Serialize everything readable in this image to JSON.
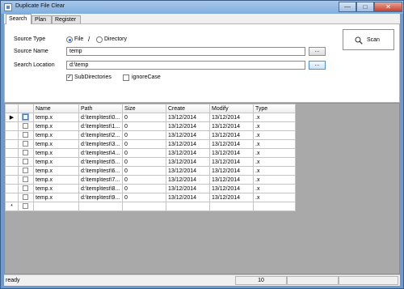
{
  "window": {
    "title": "Duplicate File Clear",
    "minimize_glyph": "—",
    "maximize_glyph": "□",
    "close_glyph": "✕"
  },
  "tabs": [
    {
      "label": "Search"
    },
    {
      "label": "Plan"
    },
    {
      "label": "Register"
    }
  ],
  "search": {
    "source_type_label": "Source Type",
    "source_name_label": "Source Name",
    "search_location_label": "Search Location",
    "file_option_label": "File",
    "directory_option_label": "Directory",
    "separator": "/",
    "source_name_value": "temp",
    "search_location_value": "d:\\temp",
    "browse_label": "...",
    "subdirectories_label": "SubDirectories",
    "ignorecase_label": "ignoreCase",
    "scan_label": "Scan"
  },
  "grid": {
    "headers": [
      "Name",
      "Path",
      "Size",
      "Create",
      "Modify",
      "Type"
    ],
    "rows": [
      [
        "temp.x",
        "d:\\temp\\test\\0...",
        "0",
        "13/12/2014",
        "13/12/2014",
        ".x"
      ],
      [
        "temp.x",
        "d:\\temp\\test\\1...",
        "0",
        "13/12/2014",
        "13/12/2014",
        ".x"
      ],
      [
        "temp.x",
        "d:\\temp\\test\\2...",
        "0",
        "13/12/2014",
        "13/12/2014",
        ".x"
      ],
      [
        "temp.x",
        "d:\\temp\\test\\3...",
        "0",
        "13/12/2014",
        "13/12/2014",
        ".x"
      ],
      [
        "temp.x",
        "d:\\temp\\test\\4...",
        "0",
        "13/12/2014",
        "13/12/2014",
        ".x"
      ],
      [
        "temp.x",
        "d:\\temp\\test\\5...",
        "0",
        "13/12/2014",
        "13/12/2014",
        ".x"
      ],
      [
        "temp.x",
        "d:\\temp\\test\\6...",
        "0",
        "13/12/2014",
        "13/12/2014",
        ".x"
      ],
      [
        "temp.x",
        "d:\\temp\\test\\7...",
        "0",
        "13/12/2014",
        "13/12/2014",
        ".x"
      ],
      [
        "temp.x",
        "d:\\temp\\test\\8...",
        "0",
        "13/12/2014",
        "13/12/2014",
        ".x"
      ],
      [
        "temp.x",
        "d:\\temp\\test\\9...",
        "0",
        "13/12/2014",
        "13/12/2014",
        ".x"
      ]
    ],
    "current_row_glyph": "▶",
    "new_row_glyph": "*"
  },
  "status": {
    "text": "ready",
    "count": "10"
  },
  "colors": {
    "accent": "#2a6bd1",
    "title_gradient_top": "#a9c8ea",
    "title_gradient_bottom": "#7faedf",
    "grid_background": "#a9a9a9"
  },
  "icons": {
    "scan": "magnifier-icon",
    "app": "app-window-icon"
  }
}
